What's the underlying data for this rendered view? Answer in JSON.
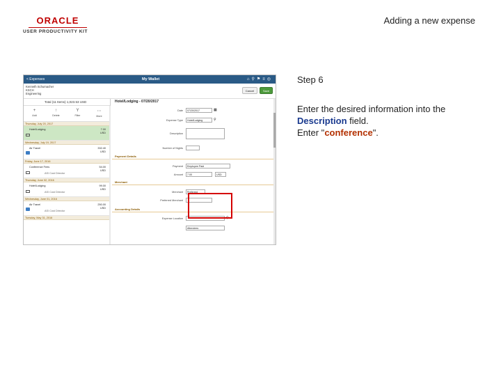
{
  "slide": {
    "logo_text": "ORACLE",
    "logo_sub": "USER PRODUCTIVITY KIT",
    "title": "Adding a new expense",
    "step": "Step 6",
    "instr_line1": "Enter the desired information into the",
    "instr_field": "Description",
    "instr_line2": "field.",
    "instr_enter": "Enter \"",
    "instr_value": "conference",
    "instr_end": "\"."
  },
  "app": {
    "back_label": "< Expenses",
    "title": "My Wallet",
    "user_name": "Kenneth Schumacher",
    "user_id": "KSCH",
    "user_role": "Engineering",
    "cancel_label": "Cancel",
    "save_label": "Save",
    "total": "Total (11 Items)   1,023.53  USD",
    "tools": [
      {
        "icon": "+",
        "label": "Add"
      },
      {
        "icon": "↑",
        "label": "Delete"
      },
      {
        "icon": "Y",
        "label": "Filter"
      },
      {
        "icon": "⋯",
        "label": "More"
      }
    ],
    "groups": [
      {
        "date": "Thursday, July 20, 2017",
        "title": "Hotel/Lodging",
        "sub": "",
        "amount": "7.00",
        "amount2": "USD",
        "selected": true
      },
      {
        "date": "Wednesday, July 19, 2017",
        "title": "Air Travel",
        "sub": "",
        "amount": "332.40",
        "amount2": "USD",
        "selected": false
      },
      {
        "date": "Friday, June 17, 2016",
        "title": "Conference Fees",
        "sub": "ASI Cost Director",
        "amount": "54.00",
        "amount2": "USD",
        "selected": false
      },
      {
        "date": "Thursday, June 02, 2016",
        "title": "Hotel/Lodging",
        "sub": "ASI Cost Director",
        "amount": "99.00",
        "amount2": "USD",
        "selected": false
      },
      {
        "date": "Wednesday, June 01, 2016",
        "title": "Air Travel",
        "sub": "ASI Cost Director",
        "amount": "250.00",
        "amount2": "USD",
        "selected": false
      },
      {
        "date": "Tuesday, May 31, 2016",
        "title": "",
        "sub": "",
        "amount": "",
        "amount2": "",
        "selected": false
      }
    ],
    "detail_title": "Hotel/Lodging - 07/20/2017",
    "fields": {
      "date_label": "Date",
      "date_value": "07/20/2017",
      "type_label": "Expense Type",
      "type_value": "Hotel/Lodging",
      "desc_label": "Description",
      "nights_label": "Number of Nights",
      "payment_section": "Payment Details",
      "payment_label": "Payment",
      "payment_value": "Employee Paid",
      "amount_label": "Amount",
      "amount_value": "7.00",
      "currency_value": "USD",
      "merchant_section": "Merchant",
      "merchant_label": "Merchant",
      "merchant_value": "Preferred",
      "pref_merchant_label": "Preferred Merchant",
      "acct_section": "Accounting Details",
      "location_label": "Expense Location",
      "attendees_label": "Attendees"
    }
  }
}
